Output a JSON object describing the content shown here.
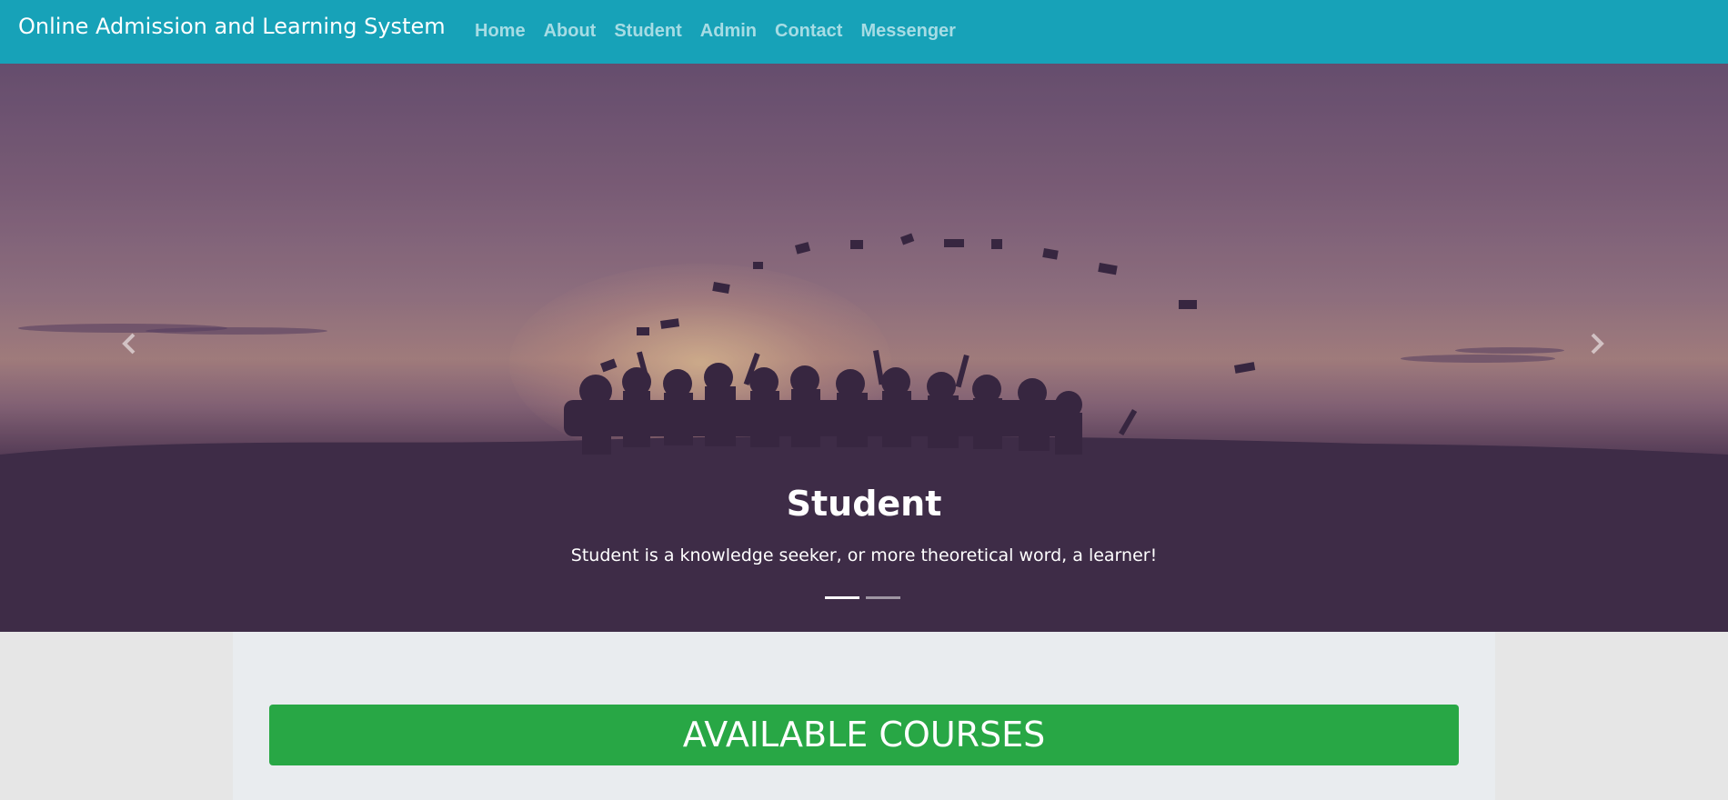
{
  "navbar": {
    "brand": "Online Admission and Learning System",
    "links": [
      "Home",
      "About",
      "Student",
      "Admin",
      "Contact",
      "Messenger"
    ],
    "bg_color": "#17a2b8"
  },
  "carousel": {
    "slide": {
      "title": "Student",
      "text": "Student is a knowledge seeker, or more theoretical word, a learner!"
    },
    "prev_icon": "chevron-left-icon",
    "next_icon": "chevron-right-icon",
    "indicator_count": 2,
    "active_index": 0
  },
  "main": {
    "banner": "AVAILABLE COURSES",
    "banner_color": "#28a745"
  }
}
